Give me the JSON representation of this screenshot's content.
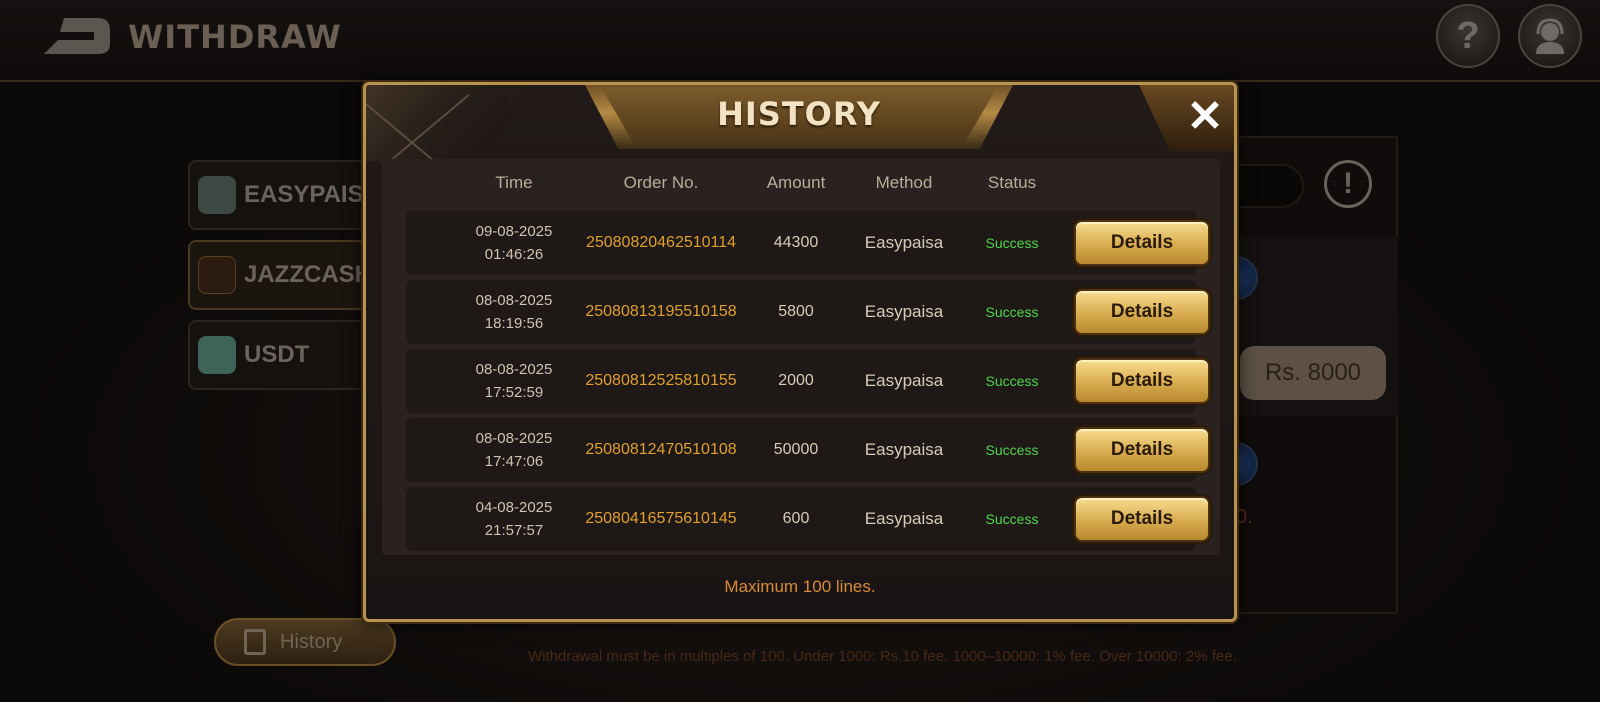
{
  "header": {
    "title": "WITHDRAW",
    "help_symbol": "?"
  },
  "payment_methods": [
    {
      "label": "EASYPAISA",
      "icon": "easypaisa-icon"
    },
    {
      "label": "JAZZCASH",
      "icon": "jazzcash-icon"
    },
    {
      "label": "USDT",
      "icon": "usdt-icon"
    }
  ],
  "right_panel": {
    "amount_chip": "Rs. 8000",
    "warning_symbol": "!",
    "partial_text": "0."
  },
  "history_button": {
    "label": "History"
  },
  "footer_note": "Withdrawal must be in multiples of 100.   Under 1000: Rs.10 fee.   1000–10000: 1% fee.   Over 10000: 2% fee.",
  "modal": {
    "title": "HISTORY",
    "close_symbol": "✕",
    "columns": [
      "Time",
      "Order No.",
      "Amount",
      "Method",
      "Status"
    ],
    "rows": [
      {
        "date": "09-08-2025",
        "time": "01:46:26",
        "order": "25080820462510114",
        "amount": "44300",
        "method": "Easypaisa",
        "status": "Success",
        "action": "Details"
      },
      {
        "date": "08-08-2025",
        "time": "18:19:56",
        "order": "25080813195510158",
        "amount": "5800",
        "method": "Easypaisa",
        "status": "Success",
        "action": "Details"
      },
      {
        "date": "08-08-2025",
        "time": "17:52:59",
        "order": "25080812525810155",
        "amount": "2000",
        "method": "Easypaisa",
        "status": "Success",
        "action": "Details"
      },
      {
        "date": "08-08-2025",
        "time": "17:47:06",
        "order": "25080812470510108",
        "amount": "50000",
        "method": "Easypaisa",
        "status": "Success",
        "action": "Details"
      },
      {
        "date": "04-08-2025",
        "time": "21:57:57",
        "order": "25080416575610145",
        "amount": "600",
        "method": "Easypaisa",
        "status": "Success",
        "action": "Details"
      }
    ],
    "footer": "Maximum 100 lines."
  },
  "colors": {
    "gold_border": "#b99450",
    "order_number": "#e0a02a",
    "status_success": "#4fd64a",
    "footer_text": "#d88a38"
  }
}
